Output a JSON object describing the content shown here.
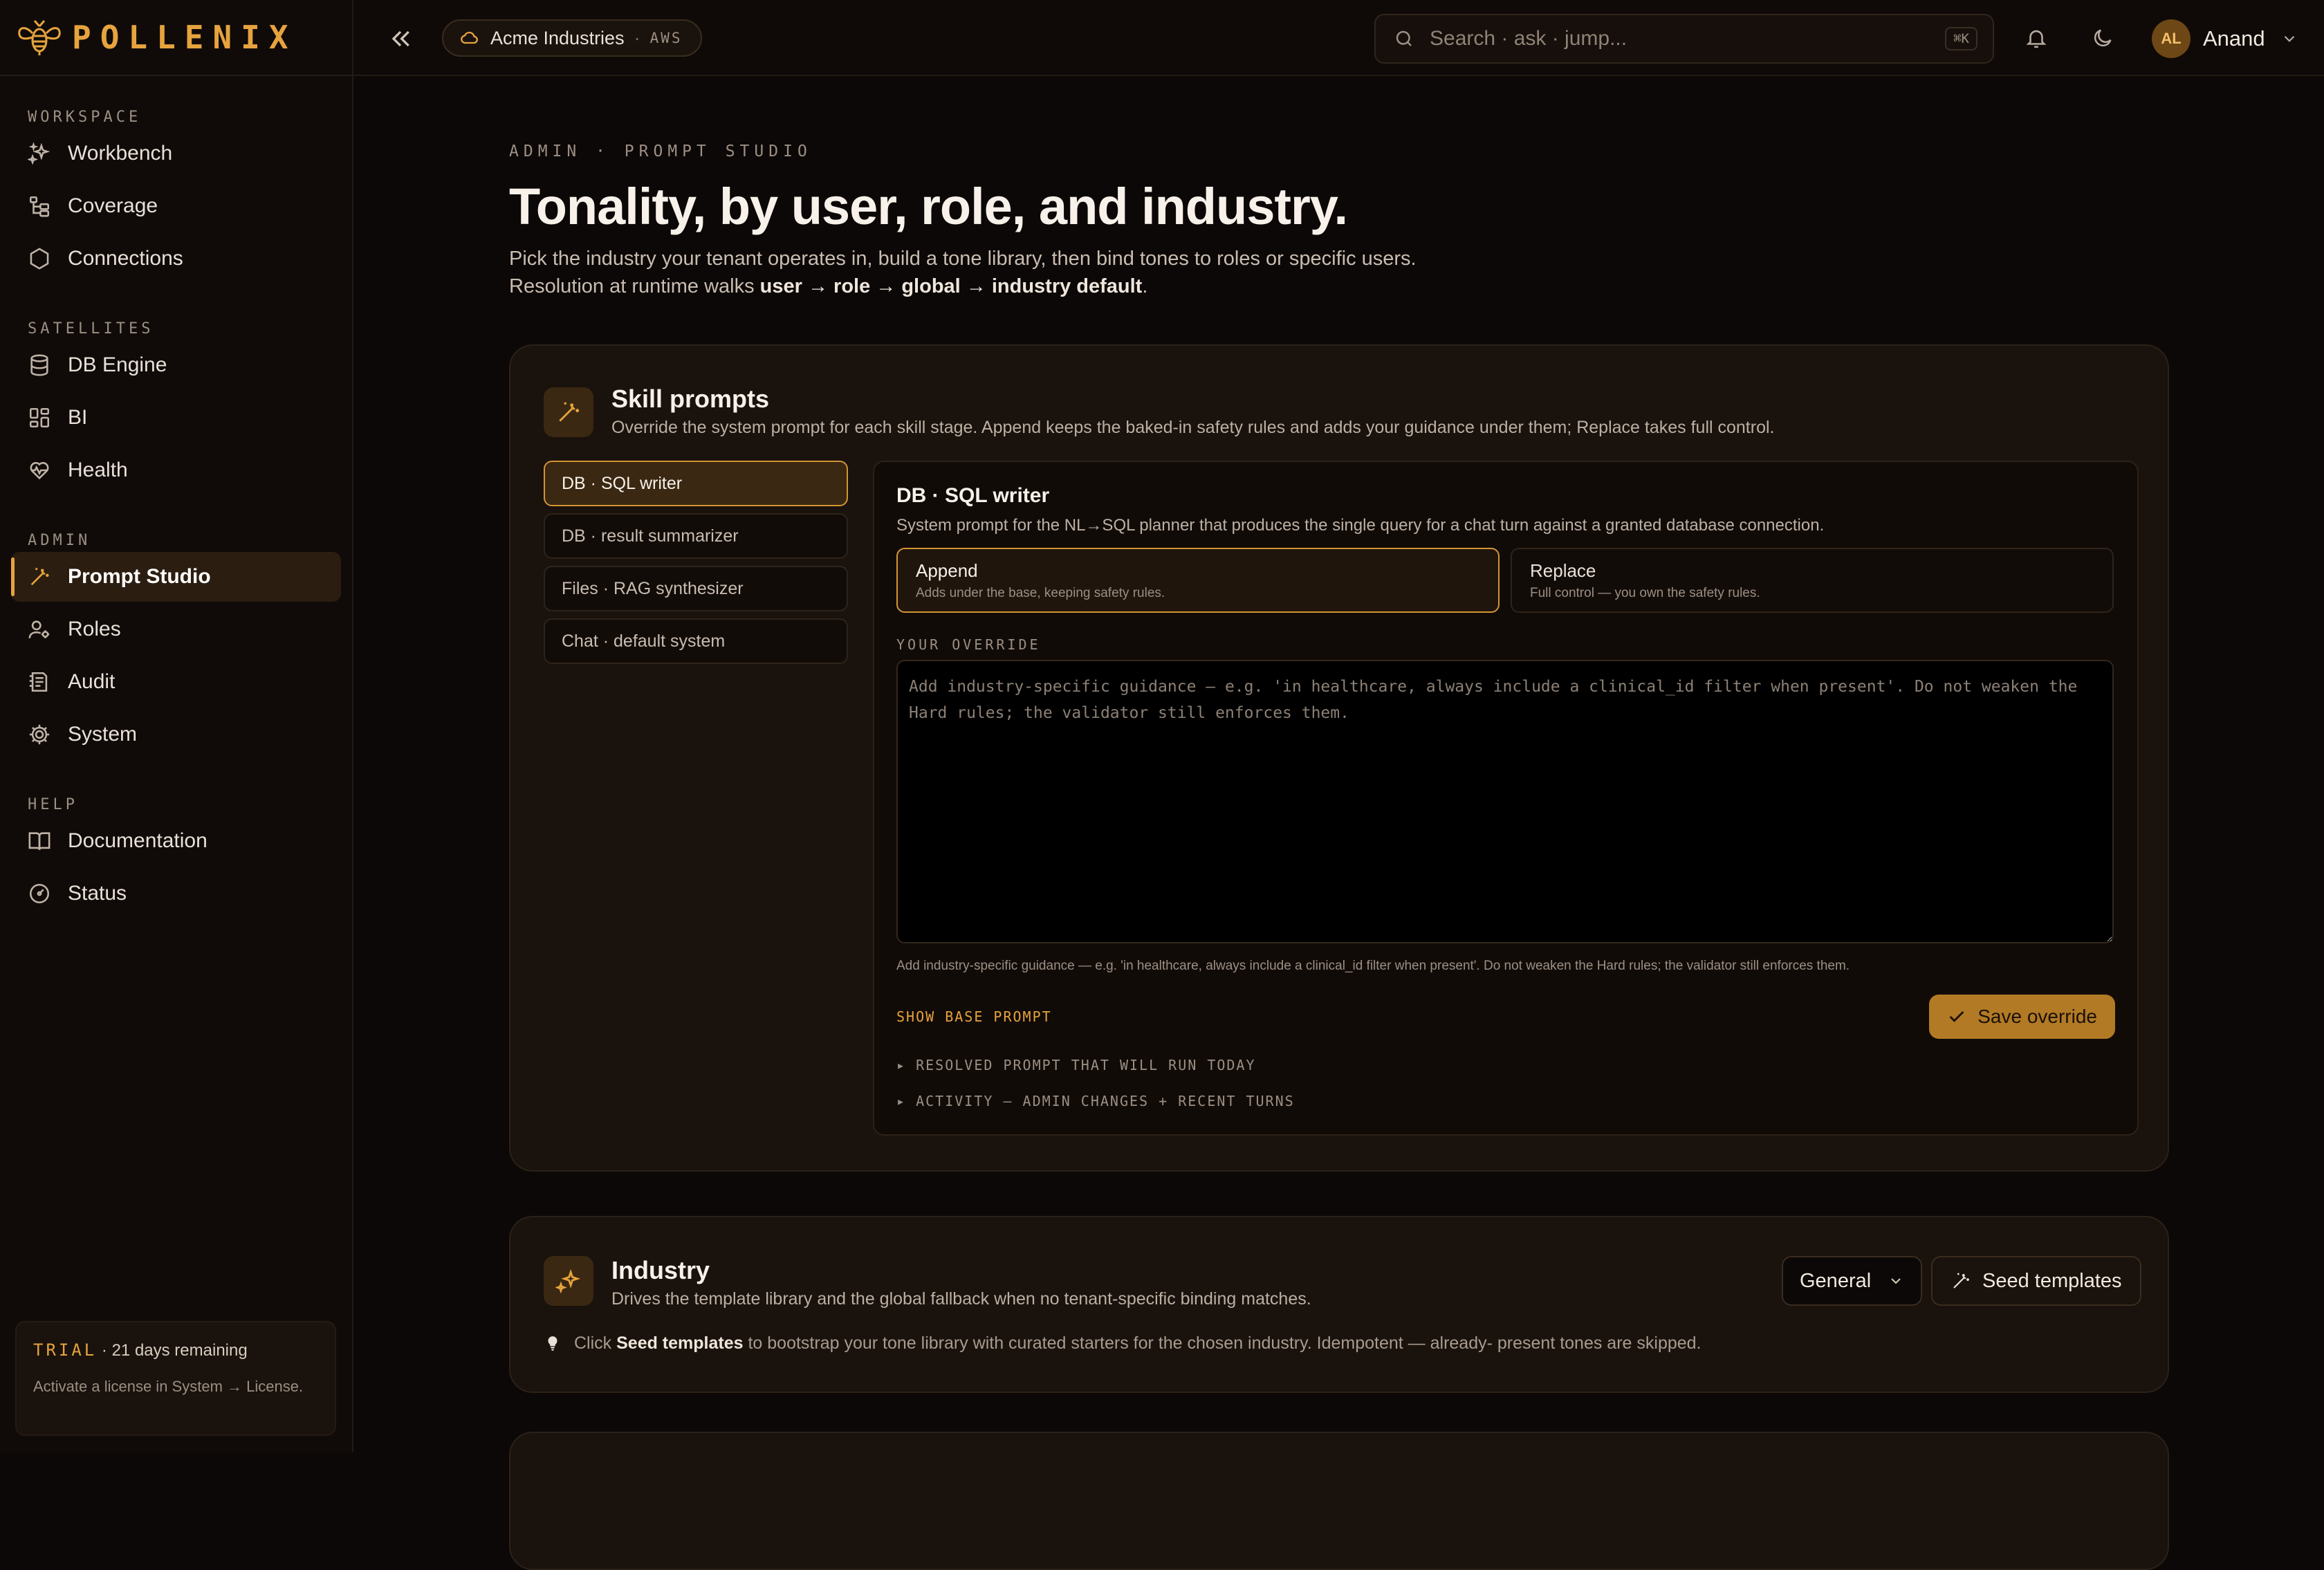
{
  "brand": {
    "name": "POLLENIX"
  },
  "sidebar": {
    "sections": [
      {
        "label": "WORKSPACE",
        "items": [
          {
            "label": "Workbench",
            "icon": "sparkles-icon"
          },
          {
            "label": "Coverage",
            "icon": "tree-icon"
          },
          {
            "label": "Connections",
            "icon": "hexagon-icon"
          }
        ]
      },
      {
        "label": "SATELLITES",
        "items": [
          {
            "label": "DB Engine",
            "icon": "database-icon"
          },
          {
            "label": "BI",
            "icon": "dashboard-icon"
          },
          {
            "label": "Health",
            "icon": "heart-pulse-icon"
          }
        ]
      },
      {
        "label": "ADMIN",
        "items": [
          {
            "label": "Prompt Studio",
            "icon": "wand-icon",
            "active": true
          },
          {
            "label": "Roles",
            "icon": "user-cog-icon"
          },
          {
            "label": "Audit",
            "icon": "audit-icon"
          },
          {
            "label": "System",
            "icon": "gear-icon"
          }
        ]
      },
      {
        "label": "HELP",
        "items": [
          {
            "label": "Documentation",
            "icon": "book-icon"
          },
          {
            "label": "Status",
            "icon": "gauge-icon"
          }
        ]
      }
    ],
    "trial": {
      "label": "TRIAL",
      "remaining": " · 21 days remaining",
      "note": "Activate a license in System → License."
    }
  },
  "topbar": {
    "tenant": "Acme Industries",
    "cloud": "AWS",
    "search_placeholder": "Search · ask · jump...",
    "shortcut": "⌘K",
    "user_initials": "AL",
    "user_name": "Anand"
  },
  "page": {
    "kicker": "ADMIN · PROMPT STUDIO",
    "title": "Tonality, by user, role, and industry.",
    "intro_line1": "Pick the industry your tenant operates in, build a tone library, then bind tones to roles or specific users.",
    "intro_line2_prefix": "Resolution at runtime walks ",
    "intro_line2_bold": "user → role → global → industry default",
    "intro_line2_suffix": "."
  },
  "skill_prompts": {
    "title": "Skill prompts",
    "subtitle": "Override the system prompt for each skill stage. Append keeps the baked-in safety rules and adds your guidance under them; Replace takes full control.",
    "skills": [
      {
        "label": "DB · SQL writer",
        "active": true
      },
      {
        "label": "DB · result summarizer"
      },
      {
        "label": "Files · RAG synthesizer"
      },
      {
        "label": "Chat · default system"
      }
    ],
    "editor": {
      "title": "DB · SQL writer",
      "subtitle": "System prompt for the NL→SQL planner that produces the single query for a chat turn against a granted database connection.",
      "modes": [
        {
          "name": "Append",
          "desc": "Adds under the base, keeping safety rules.",
          "active": true
        },
        {
          "name": "Replace",
          "desc": "Full control — you own the safety rules."
        }
      ],
      "override_label": "YOUR OVERRIDE",
      "override_value": "",
      "override_placeholder": "Add industry-specific guidance — e.g. 'in healthcare, always include a clinical_id filter when present'. Do not weaken the Hard rules; the validator still enforces them.",
      "help": "Add industry-specific guidance — e.g. 'in healthcare, always include a clinical_id filter when present'. Do not weaken the Hard rules; the validator still enforces them.",
      "show_base": "SHOW BASE PROMPT",
      "save_label": "Save override",
      "resolved": "▸ RESOLVED PROMPT THAT WILL RUN TODAY",
      "activity": "▸ ACTIVITY — ADMIN CHANGES + RECENT TURNS"
    }
  },
  "industry": {
    "title": "Industry",
    "subtitle": "Drives the template library and the global fallback when no tenant-specific binding matches.",
    "selected": "General",
    "seed_label": "Seed templates",
    "tip_prefix": "Click ",
    "tip_bold": "Seed templates",
    "tip_suffix": " to bootstrap your tone library with curated starters for the chosen industry. Idempotent — already- present tones are skipped."
  },
  "colors": {
    "accent": "#e6a33e",
    "background": "#0c0807",
    "card": "#1a120c"
  }
}
